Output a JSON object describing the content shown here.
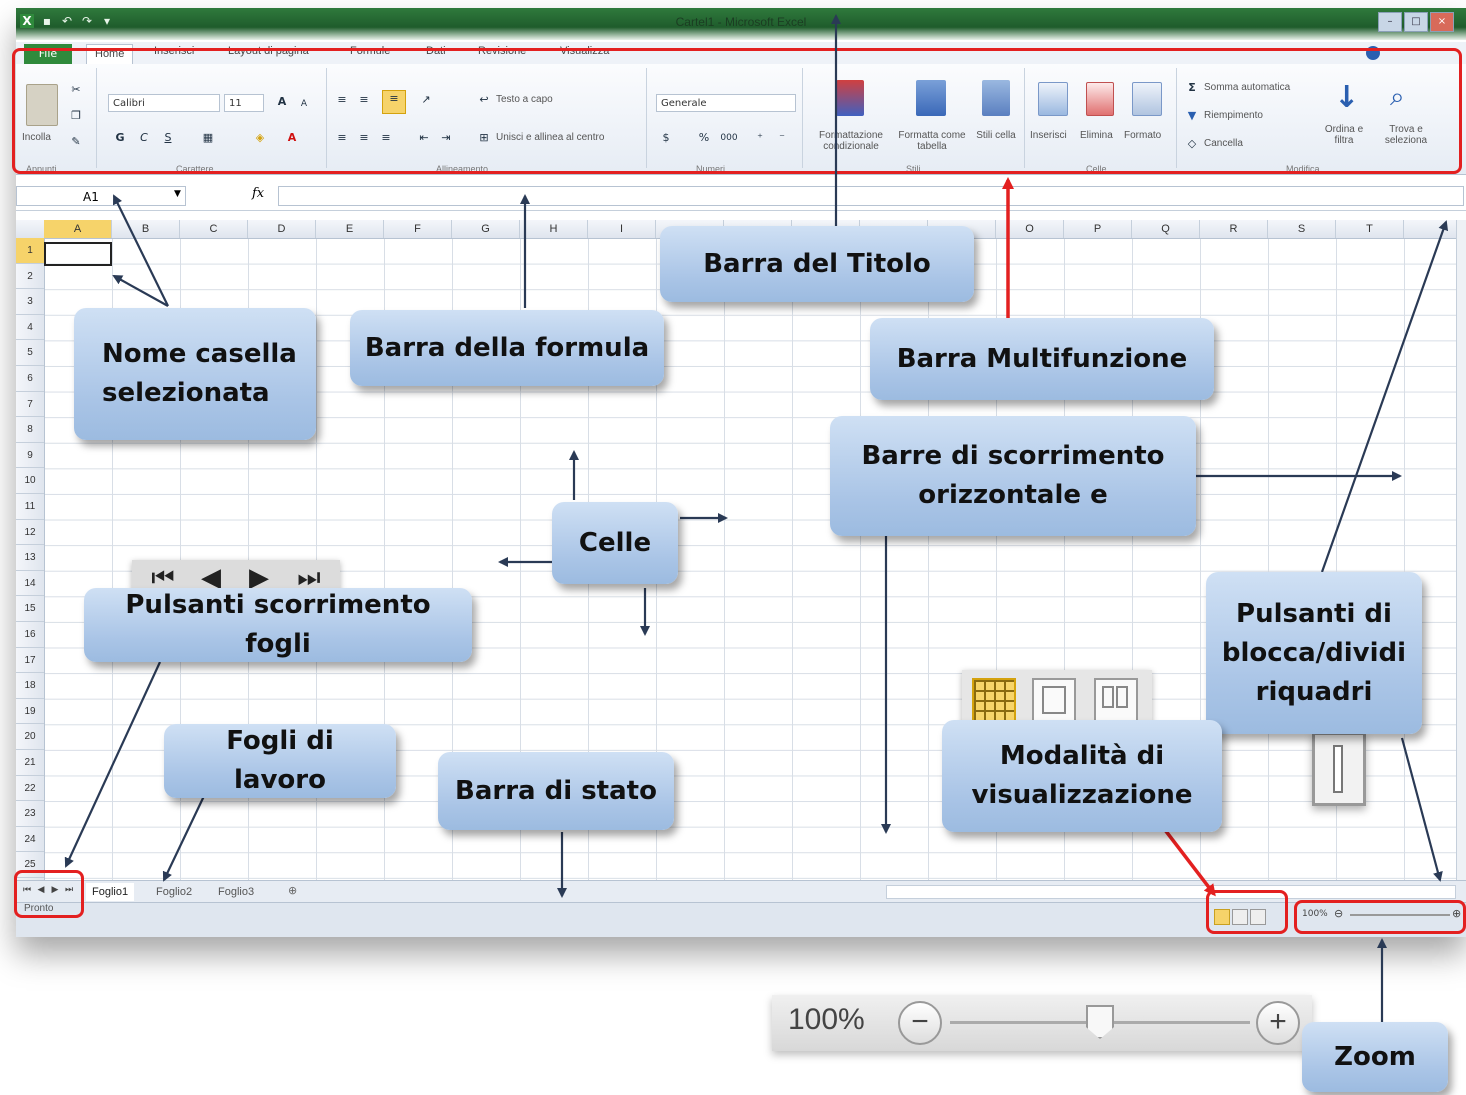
{
  "window": {
    "title": "Cartel1 - Microsoft Excel",
    "qat_icons": [
      "excel-icon",
      "save-icon",
      "undo-icon",
      "redo-icon",
      "customize-icon"
    ],
    "controls": [
      "–",
      "□",
      "×"
    ]
  },
  "ribbon": {
    "file_tab": "File",
    "tabs": [
      "Home",
      "Inserisci",
      "Layout di pagina",
      "Formule",
      "Dati",
      "Revisione",
      "Visualizza"
    ],
    "clipboard": {
      "paste": "Incolla",
      "group": "Appunti"
    },
    "font": {
      "name": "Calibri",
      "size": "11",
      "bold": "G",
      "italic": "C",
      "underline": "S",
      "group": "Carattere"
    },
    "alignment": {
      "wrap": "Testo a capo",
      "merge": "Unisci e allinea al centro",
      "group": "Allineamento"
    },
    "number": {
      "format": "Generale",
      "percent": "%",
      "thousands": "000",
      "group": "Numeri"
    },
    "styles": {
      "conditional": "Formattazione condizionale",
      "as_table": "Formatta come tabella",
      "cell_styles": "Stili cella",
      "group": "Stili"
    },
    "cells": {
      "insert": "Inserisci",
      "delete": "Elimina",
      "format": "Formato",
      "group": "Celle"
    },
    "editing": {
      "autosum": "Somma automatica",
      "fill": "Riempimento",
      "clear": "Cancella",
      "sort": "Ordina e filtra",
      "find": "Trova e seleziona",
      "group": "Modifica"
    }
  },
  "formula_bar": {
    "name_box": "A1",
    "fx": "fx",
    "value": ""
  },
  "columns": [
    "A",
    "B",
    "C",
    "D",
    "E",
    "F",
    "G",
    "H",
    "I",
    "",
    "",
    "",
    "",
    "",
    "O",
    "P",
    "Q",
    "R",
    "S",
    "T"
  ],
  "rows": [
    "1",
    "2",
    "3",
    "4",
    "5",
    "6",
    "7",
    "8",
    "9",
    "10",
    "11",
    "12",
    "13",
    "14",
    "15",
    "16",
    "17",
    "18",
    "19",
    "20",
    "21",
    "22",
    "23",
    "24",
    "25"
  ],
  "sheets": [
    "Foglio1",
    "Foglio2",
    "Foglio3"
  ],
  "status": {
    "ready": "Pronto",
    "zoom_small": "100%"
  },
  "callouts": {
    "title_bar": "Barra del Titolo",
    "name_box": [
      "Nome casella",
      "selezionata"
    ],
    "formula_bar": "Barra della formula",
    "ribbon": "Barra Multifunzione",
    "scrollbars": [
      "Barre di scorrimento",
      "orizzontale e"
    ],
    "cells": "Celle",
    "sheet_scroll": "Pulsanti scorrimento fogli",
    "freeze": [
      "Pulsanti di",
      "blocca/dividi",
      "riquadri"
    ],
    "sheets": "Fogli di lavoro",
    "status_bar": "Barra di stato",
    "view_modes": [
      "Modalità di",
      "visualizzazione"
    ],
    "zoom": "Zoom"
  },
  "nav_glyphs": [
    "⏮",
    "◀",
    "▶",
    "⏭"
  ],
  "zoom_panel": {
    "value": "100%",
    "minus": "−",
    "plus": "+",
    "level": 0.5
  },
  "colors": {
    "accent_red": "#e32020",
    "excel_green": "#2f8a3c",
    "callout_blue": "#a9c4e6"
  }
}
